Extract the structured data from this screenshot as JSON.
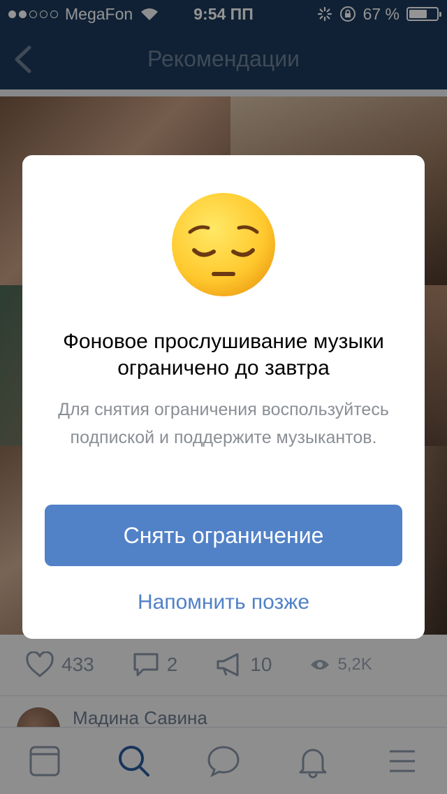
{
  "status_bar": {
    "carrier": "MegaFon",
    "time": "9:54 ПП",
    "battery": "67 %",
    "battery_level": 0.67
  },
  "nav": {
    "title": "Рекомендации"
  },
  "post": {
    "likes": "433",
    "comments": "2",
    "reposts": "10",
    "views": "5,2K",
    "commenter_name": "Мадина Савина"
  },
  "modal": {
    "title": "Фоновое прослушивание музыки ограничено до завтра",
    "text": "Для снятия ограничения воспользуйтесь подпиской и поддержите музыкантов.",
    "primary_button": "Снять ограничение",
    "secondary_link": "Напомнить позже"
  },
  "colors": {
    "header": "#1c3a5c",
    "accent": "#5181c7"
  }
}
